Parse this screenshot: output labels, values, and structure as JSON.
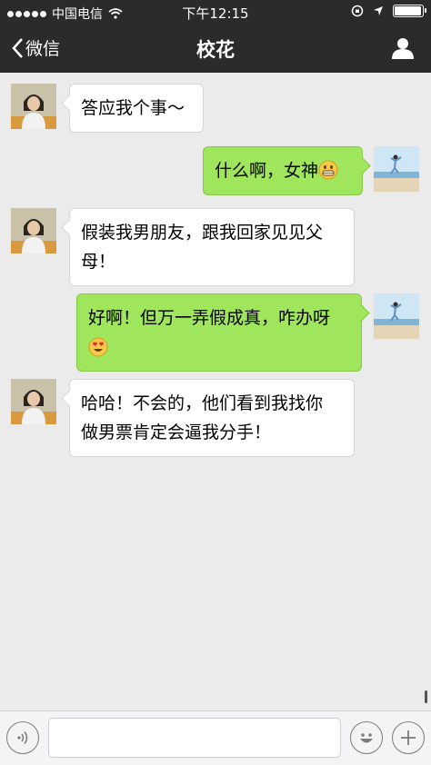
{
  "status_bar": {
    "carrier": "中国电信",
    "time": "下午12:15",
    "battery_level": 0.95
  },
  "nav": {
    "back_label": "微信",
    "title": "校花"
  },
  "messages": [
    {
      "side": "left",
      "text": "答应我个事～"
    },
    {
      "side": "right",
      "text": "什么啊，女神",
      "emoji": "grin-face"
    },
    {
      "side": "left",
      "line1": "假装我男朋友，跟我回家见见父",
      "line2": "母！"
    },
    {
      "side": "right",
      "line1": "好啊！但万一弄假成真，咋办呀",
      "emoji": "heart-eyes-face"
    },
    {
      "side": "left",
      "line1": "哈哈！不会的，他们看到我找你",
      "line2": "做男票肯定会逼我分手！"
    }
  ],
  "input_bar": {
    "text_value": "",
    "icons": [
      "voice-icon",
      "emoji-icon",
      "plus-icon"
    ]
  },
  "colors": {
    "bar_bg": "#2b2b2b",
    "chat_bg": "#ebebeb",
    "bubble_green": "#9fe65c",
    "bubble_white": "#ffffff"
  }
}
